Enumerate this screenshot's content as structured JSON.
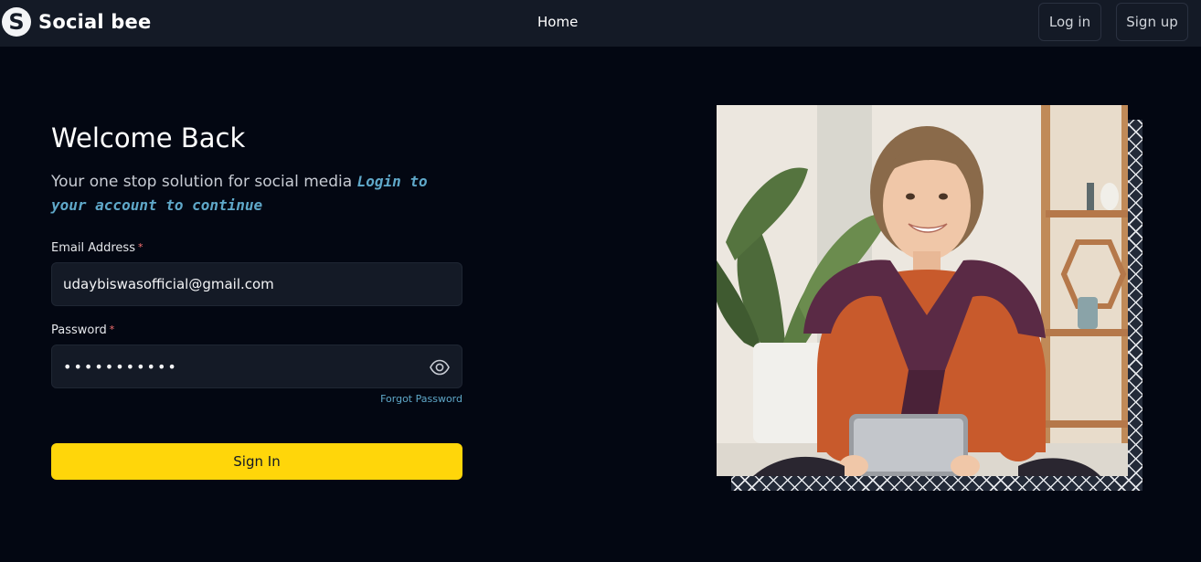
{
  "nav": {
    "brand_initial": "S",
    "brand_name": "Social bee",
    "home_label": "Home",
    "login_label": "Log in",
    "signup_label": "Sign up"
  },
  "form": {
    "title": "Welcome Back",
    "subtitle": "Your one stop solution for social media",
    "subtitle_accent": "Login to your account to continue",
    "email_label": "Email Address",
    "email_value": "udaybiswasofficial@gmail.com",
    "password_label": "Password",
    "password_value": "•••••••••••",
    "required_mark": "*",
    "forgot_label": "Forgot Password",
    "signin_label": "Sign In"
  },
  "icons": {
    "password_toggle": "eye-icon",
    "logo": "social-bee-logo"
  },
  "colors": {
    "page_bg": "#030712",
    "nav_bg": "#141a26",
    "input_bg": "#141a26",
    "accent": "#5fa8c9",
    "button": "#ffd60a",
    "required": "#f87171"
  }
}
